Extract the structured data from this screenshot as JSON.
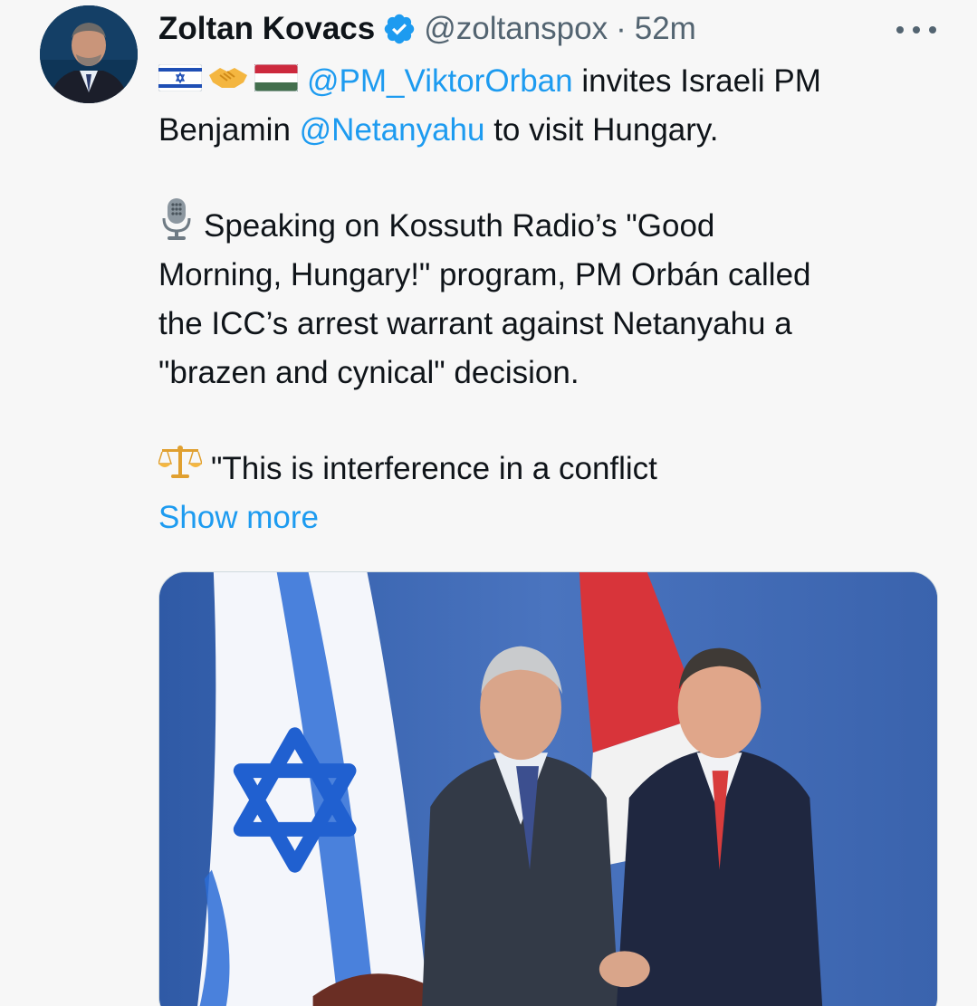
{
  "tweet": {
    "author_name": "Zoltan Kovacs",
    "author_handle": "@zoltanspox",
    "separator": "·",
    "timestamp": "52m",
    "lines": {
      "l1_mention": "@PM_ViktorOrban",
      "l1_text": " invites Israeli PM",
      "l2_text_a": "Benjamin ",
      "l2_mention": "@Netanyahu",
      "l2_text_b": " to visit Hungary.",
      "p2_l1": "Speaking on Kossuth Radio’s \"Good",
      "p2_l2": "Morning, Hungary!\" program, PM Orbán called",
      "p2_l3": "the ICC’s arrest warrant against Netanyahu a",
      "p2_l4": "\"brazen and cynical\" decision.",
      "p3_l1": "\"This is interference in a conflict"
    },
    "show_more": "Show more"
  },
  "icons": {
    "avatar": "profile-photo",
    "verified": "verified-badge-icon",
    "more": "more-options-icon",
    "flag1": "israel-flag-emoji",
    "handshake": "handshake-emoji",
    "flag2": "hungary-flag-emoji",
    "microphone": "microphone-emoji",
    "scales": "balance-scale-emoji"
  },
  "colors": {
    "link": "#1d9bf0",
    "secondary_text": "#536471",
    "verified": "#1d9bf0"
  }
}
